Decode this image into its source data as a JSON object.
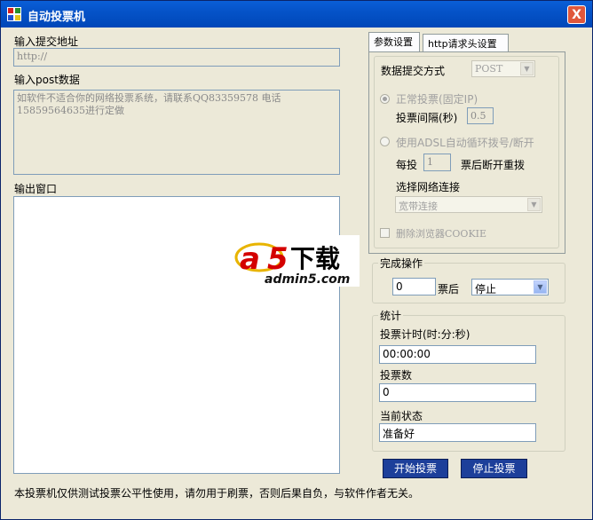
{
  "window": {
    "title": "自动投票机",
    "close_glyph": "X"
  },
  "left": {
    "url_label": "输入提交地址",
    "url_placeholder": "http://",
    "post_label": "输入post数据",
    "post_text": "如软件不适合你的网络投票系统，请联系QQ83359578  电话15859564635进行定做",
    "output_label": "输出窗口"
  },
  "tabs": [
    {
      "label": "参数设置",
      "active": true
    },
    {
      "label": "http请求头设置",
      "active": false
    }
  ],
  "params": {
    "submit_method_label": "数据提交方式",
    "submit_method_value": "POST",
    "normal_vote_label": "正常投票(固定IP)",
    "interval_label": "投票间隔(秒)",
    "interval_value": "0.5",
    "adsl_label": "使用ADSL自动循环拨号/断开",
    "every_label": "每投",
    "every_value": "1",
    "redial_label": "票后断开重拨",
    "select_conn_label": "选择网络连接",
    "conn_value": "宽带连接",
    "clear_cookie_label": "删除浏览器COOKIE"
  },
  "complete": {
    "title": "完成操作",
    "count_value": "0",
    "after_label": "票后",
    "action_value": "停止"
  },
  "stats": {
    "title": "统计",
    "timer_label": "投票计时(时:分:秒)",
    "timer_value": "00:00:00",
    "count_label": "投票数",
    "count_value": "0",
    "status_label": "当前状态",
    "status_value": "准备好"
  },
  "buttons": {
    "start": "开始投票",
    "stop": "停止投票"
  },
  "footer": "本投票机仅供测试投票公平性使用，请勿用于刷票，否则后果自负，与软件作者无关。",
  "watermark": {
    "brand": "a5下载",
    "site": "admin5.com"
  }
}
